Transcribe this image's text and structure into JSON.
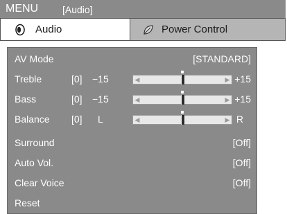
{
  "title": {
    "menu": "MENU",
    "section": "[Audio]"
  },
  "tabs": [
    {
      "label": "Audio",
      "icon": "audio-speaker-icon",
      "active": true
    },
    {
      "label": "Power Control",
      "icon": "leaf-icon",
      "active": false
    }
  ],
  "rows": {
    "av_mode": {
      "label": "AV Mode",
      "value": "[STANDARD]"
    },
    "treble": {
      "label": "Treble",
      "value": "[0]",
      "min": "−15",
      "max": "+15",
      "level": 0.5
    },
    "bass": {
      "label": "Bass",
      "value": "[0]",
      "min": "−15",
      "max": "+15",
      "level": 0.5
    },
    "balance": {
      "label": "Balance",
      "value": "[0]",
      "min": "L",
      "max": "R",
      "level": 0.5
    },
    "surround": {
      "label": "Surround",
      "value": "[Off]"
    },
    "auto_vol": {
      "label": "Auto Vol.",
      "value": "[Off]"
    },
    "clear_voice": {
      "label": "Clear Voice",
      "value": "[Off]"
    },
    "reset": {
      "label": "Reset"
    }
  },
  "colors": {
    "panel": "#8a8a8a",
    "title_bar": "#8a8a8a",
    "inactive_tab": "#b5b5b5",
    "text": "#ffffff"
  }
}
